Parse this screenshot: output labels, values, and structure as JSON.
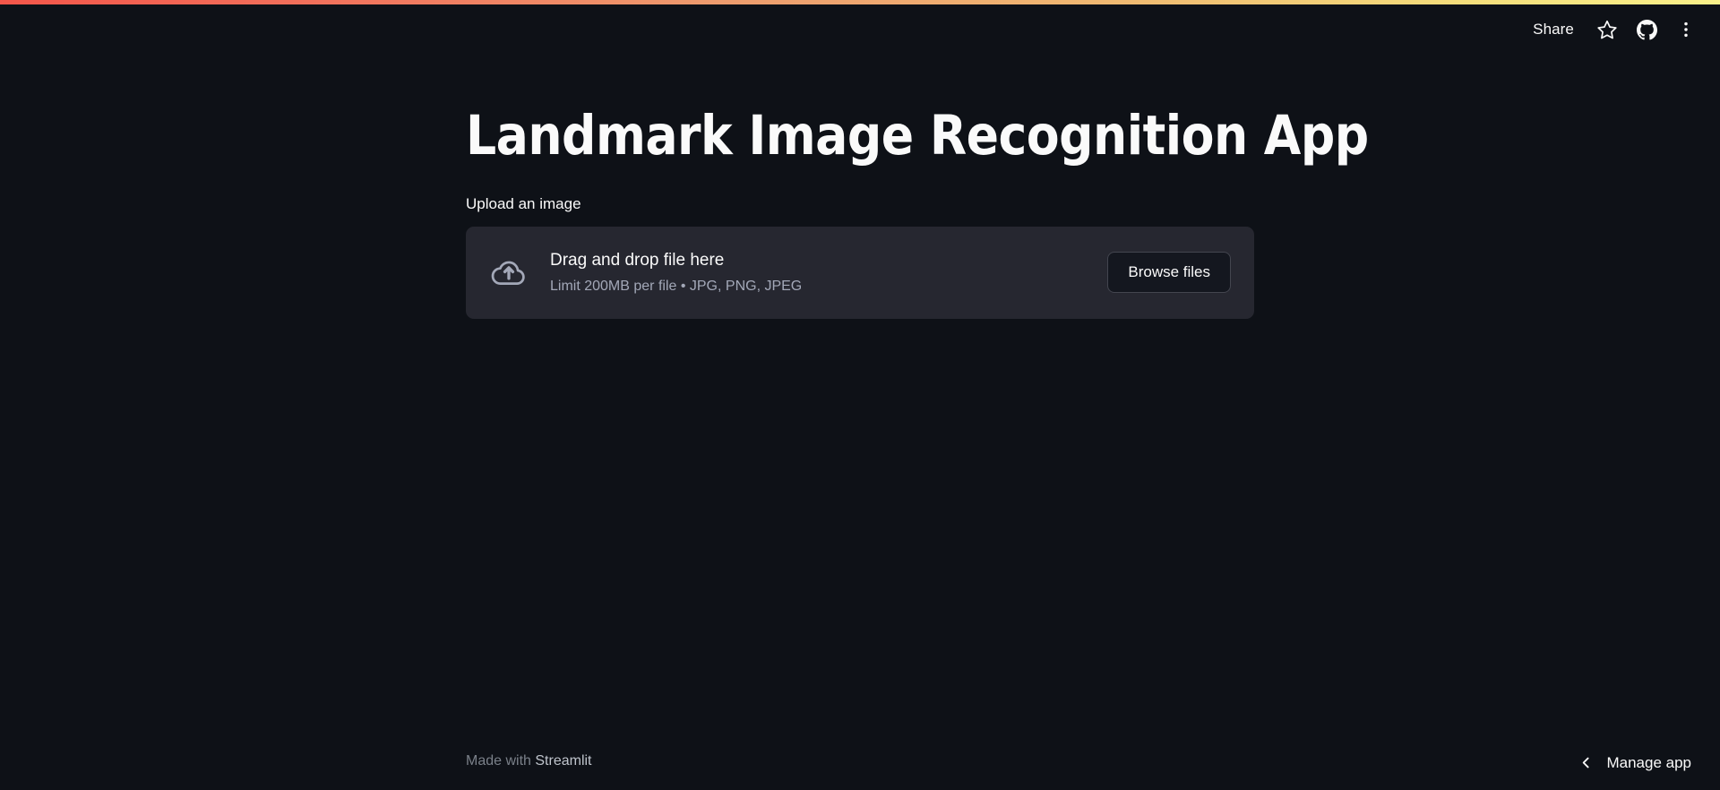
{
  "theme": {
    "background": "#0E1117",
    "secondary_background": "#262730",
    "text_color": "#FAFAFA",
    "muted_text_color": "#A3A8B8",
    "accent_color": "#FF4B4B",
    "gradient_start": "#F4564A",
    "gradient_mid": "#EE9C6E",
    "gradient_end": "#FAF18A"
  },
  "header": {
    "share_label": "Share",
    "star_icon": "star-icon",
    "github_icon": "github-icon",
    "overflow_icon": "more-vertical-icon"
  },
  "main": {
    "title": "Landmark Image Recognition App",
    "uploader": {
      "label": "Upload an image",
      "icon": "cloud-upload-icon",
      "drop_title": "Drag and drop file here",
      "drop_hint": "Limit 200MB per file • JPG, PNG, JPEG",
      "browse_label": "Browse files"
    }
  },
  "footer": {
    "made_with": "Made with",
    "brand": "Streamlit",
    "manage_app_label": "Manage app",
    "back_icon": "chevron-left-icon"
  }
}
